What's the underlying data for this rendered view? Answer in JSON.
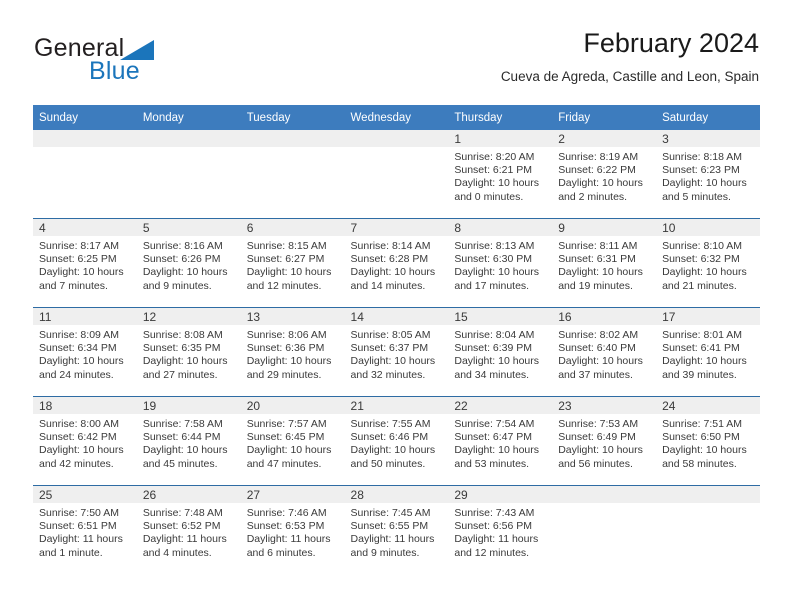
{
  "brand": {
    "name_part1": "General",
    "name_part2": "Blue",
    "logo_icon": "triangle-logo-icon",
    "accent_color": "#1b75bb"
  },
  "header": {
    "title": "February 2024",
    "subtitle": "Cueva de Agreda, Castille and Leon, Spain"
  },
  "calendar": {
    "header_bg_color": "#3d7cbe",
    "daynum_band_color": "#efefef",
    "row_divider_color": "#2e6ca4",
    "weekday_headers": [
      "Sunday",
      "Monday",
      "Tuesday",
      "Wednesday",
      "Thursday",
      "Friday",
      "Saturday"
    ],
    "weeks": [
      [
        {
          "day": "",
          "empty": true,
          "sunrise": "",
          "sunset": "",
          "daylight_line1": "",
          "daylight_line2": ""
        },
        {
          "day": "",
          "empty": true,
          "sunrise": "",
          "sunset": "",
          "daylight_line1": "",
          "daylight_line2": ""
        },
        {
          "day": "",
          "empty": true,
          "sunrise": "",
          "sunset": "",
          "daylight_line1": "",
          "daylight_line2": ""
        },
        {
          "day": "",
          "empty": true,
          "sunrise": "",
          "sunset": "",
          "daylight_line1": "",
          "daylight_line2": ""
        },
        {
          "day": "1",
          "empty": false,
          "sunrise": "Sunrise: 8:20 AM",
          "sunset": "Sunset: 6:21 PM",
          "daylight_line1": "Daylight: 10 hours",
          "daylight_line2": "and 0 minutes."
        },
        {
          "day": "2",
          "empty": false,
          "sunrise": "Sunrise: 8:19 AM",
          "sunset": "Sunset: 6:22 PM",
          "daylight_line1": "Daylight: 10 hours",
          "daylight_line2": "and 2 minutes."
        },
        {
          "day": "3",
          "empty": false,
          "sunrise": "Sunrise: 8:18 AM",
          "sunset": "Sunset: 6:23 PM",
          "daylight_line1": "Daylight: 10 hours",
          "daylight_line2": "and 5 minutes."
        }
      ],
      [
        {
          "day": "4",
          "empty": false,
          "sunrise": "Sunrise: 8:17 AM",
          "sunset": "Sunset: 6:25 PM",
          "daylight_line1": "Daylight: 10 hours",
          "daylight_line2": "and 7 minutes."
        },
        {
          "day": "5",
          "empty": false,
          "sunrise": "Sunrise: 8:16 AM",
          "sunset": "Sunset: 6:26 PM",
          "daylight_line1": "Daylight: 10 hours",
          "daylight_line2": "and 9 minutes."
        },
        {
          "day": "6",
          "empty": false,
          "sunrise": "Sunrise: 8:15 AM",
          "sunset": "Sunset: 6:27 PM",
          "daylight_line1": "Daylight: 10 hours",
          "daylight_line2": "and 12 minutes."
        },
        {
          "day": "7",
          "empty": false,
          "sunrise": "Sunrise: 8:14 AM",
          "sunset": "Sunset: 6:28 PM",
          "daylight_line1": "Daylight: 10 hours",
          "daylight_line2": "and 14 minutes."
        },
        {
          "day": "8",
          "empty": false,
          "sunrise": "Sunrise: 8:13 AM",
          "sunset": "Sunset: 6:30 PM",
          "daylight_line1": "Daylight: 10 hours",
          "daylight_line2": "and 17 minutes."
        },
        {
          "day": "9",
          "empty": false,
          "sunrise": "Sunrise: 8:11 AM",
          "sunset": "Sunset: 6:31 PM",
          "daylight_line1": "Daylight: 10 hours",
          "daylight_line2": "and 19 minutes."
        },
        {
          "day": "10",
          "empty": false,
          "sunrise": "Sunrise: 8:10 AM",
          "sunset": "Sunset: 6:32 PM",
          "daylight_line1": "Daylight: 10 hours",
          "daylight_line2": "and 21 minutes."
        }
      ],
      [
        {
          "day": "11",
          "empty": false,
          "sunrise": "Sunrise: 8:09 AM",
          "sunset": "Sunset: 6:34 PM",
          "daylight_line1": "Daylight: 10 hours",
          "daylight_line2": "and 24 minutes."
        },
        {
          "day": "12",
          "empty": false,
          "sunrise": "Sunrise: 8:08 AM",
          "sunset": "Sunset: 6:35 PM",
          "daylight_line1": "Daylight: 10 hours",
          "daylight_line2": "and 27 minutes."
        },
        {
          "day": "13",
          "empty": false,
          "sunrise": "Sunrise: 8:06 AM",
          "sunset": "Sunset: 6:36 PM",
          "daylight_line1": "Daylight: 10 hours",
          "daylight_line2": "and 29 minutes."
        },
        {
          "day": "14",
          "empty": false,
          "sunrise": "Sunrise: 8:05 AM",
          "sunset": "Sunset: 6:37 PM",
          "daylight_line1": "Daylight: 10 hours",
          "daylight_line2": "and 32 minutes."
        },
        {
          "day": "15",
          "empty": false,
          "sunrise": "Sunrise: 8:04 AM",
          "sunset": "Sunset: 6:39 PM",
          "daylight_line1": "Daylight: 10 hours",
          "daylight_line2": "and 34 minutes."
        },
        {
          "day": "16",
          "empty": false,
          "sunrise": "Sunrise: 8:02 AM",
          "sunset": "Sunset: 6:40 PM",
          "daylight_line1": "Daylight: 10 hours",
          "daylight_line2": "and 37 minutes."
        },
        {
          "day": "17",
          "empty": false,
          "sunrise": "Sunrise: 8:01 AM",
          "sunset": "Sunset: 6:41 PM",
          "daylight_line1": "Daylight: 10 hours",
          "daylight_line2": "and 39 minutes."
        }
      ],
      [
        {
          "day": "18",
          "empty": false,
          "sunrise": "Sunrise: 8:00 AM",
          "sunset": "Sunset: 6:42 PM",
          "daylight_line1": "Daylight: 10 hours",
          "daylight_line2": "and 42 minutes."
        },
        {
          "day": "19",
          "empty": false,
          "sunrise": "Sunrise: 7:58 AM",
          "sunset": "Sunset: 6:44 PM",
          "daylight_line1": "Daylight: 10 hours",
          "daylight_line2": "and 45 minutes."
        },
        {
          "day": "20",
          "empty": false,
          "sunrise": "Sunrise: 7:57 AM",
          "sunset": "Sunset: 6:45 PM",
          "daylight_line1": "Daylight: 10 hours",
          "daylight_line2": "and 47 minutes."
        },
        {
          "day": "21",
          "empty": false,
          "sunrise": "Sunrise: 7:55 AM",
          "sunset": "Sunset: 6:46 PM",
          "daylight_line1": "Daylight: 10 hours",
          "daylight_line2": "and 50 minutes."
        },
        {
          "day": "22",
          "empty": false,
          "sunrise": "Sunrise: 7:54 AM",
          "sunset": "Sunset: 6:47 PM",
          "daylight_line1": "Daylight: 10 hours",
          "daylight_line2": "and 53 minutes."
        },
        {
          "day": "23",
          "empty": false,
          "sunrise": "Sunrise: 7:53 AM",
          "sunset": "Sunset: 6:49 PM",
          "daylight_line1": "Daylight: 10 hours",
          "daylight_line2": "and 56 minutes."
        },
        {
          "day": "24",
          "empty": false,
          "sunrise": "Sunrise: 7:51 AM",
          "sunset": "Sunset: 6:50 PM",
          "daylight_line1": "Daylight: 10 hours",
          "daylight_line2": "and 58 minutes."
        }
      ],
      [
        {
          "day": "25",
          "empty": false,
          "sunrise": "Sunrise: 7:50 AM",
          "sunset": "Sunset: 6:51 PM",
          "daylight_line1": "Daylight: 11 hours",
          "daylight_line2": "and 1 minute."
        },
        {
          "day": "26",
          "empty": false,
          "sunrise": "Sunrise: 7:48 AM",
          "sunset": "Sunset: 6:52 PM",
          "daylight_line1": "Daylight: 11 hours",
          "daylight_line2": "and 4 minutes."
        },
        {
          "day": "27",
          "empty": false,
          "sunrise": "Sunrise: 7:46 AM",
          "sunset": "Sunset: 6:53 PM",
          "daylight_line1": "Daylight: 11 hours",
          "daylight_line2": "and 6 minutes."
        },
        {
          "day": "28",
          "empty": false,
          "sunrise": "Sunrise: 7:45 AM",
          "sunset": "Sunset: 6:55 PM",
          "daylight_line1": "Daylight: 11 hours",
          "daylight_line2": "and 9 minutes."
        },
        {
          "day": "29",
          "empty": false,
          "sunrise": "Sunrise: 7:43 AM",
          "sunset": "Sunset: 6:56 PM",
          "daylight_line1": "Daylight: 11 hours",
          "daylight_line2": "and 12 minutes."
        },
        {
          "day": "",
          "empty": true,
          "sunrise": "",
          "sunset": "",
          "daylight_line1": "",
          "daylight_line2": ""
        },
        {
          "day": "",
          "empty": true,
          "sunrise": "",
          "sunset": "",
          "daylight_line1": "",
          "daylight_line2": ""
        }
      ]
    ]
  }
}
